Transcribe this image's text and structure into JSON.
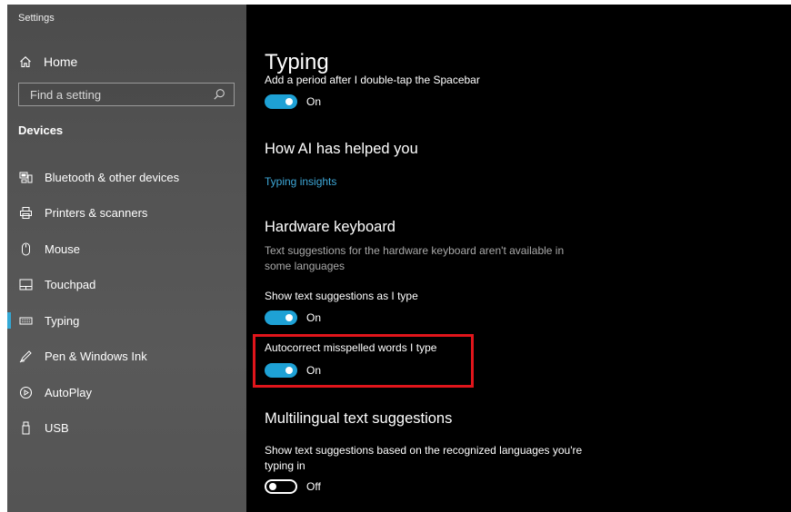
{
  "app": {
    "title": "Settings"
  },
  "sidebar": {
    "home_label": "Home",
    "search_placeholder": "Find a setting",
    "section_label": "Devices",
    "items": [
      {
        "label": "Bluetooth & other devices",
        "icon": "bluetooth-devices-icon"
      },
      {
        "label": "Printers & scanners",
        "icon": "printer-icon"
      },
      {
        "label": "Mouse",
        "icon": "mouse-icon"
      },
      {
        "label": "Touchpad",
        "icon": "touchpad-icon"
      },
      {
        "label": "Typing",
        "icon": "keyboard-icon",
        "selected": true
      },
      {
        "label": "Pen & Windows Ink",
        "icon": "pen-icon"
      },
      {
        "label": "AutoPlay",
        "icon": "autoplay-icon"
      },
      {
        "label": "USB",
        "icon": "usb-icon"
      }
    ],
    "accent_color": "#33a9d6"
  },
  "content": {
    "page_title": "Typing",
    "period_setting": {
      "label": "Add a period after I double-tap the Spacebar",
      "state": "On"
    },
    "ai_section": {
      "heading": "How AI has helped you",
      "link": "Typing insights"
    },
    "hardware_section": {
      "heading": "Hardware keyboard",
      "description": "Text suggestions for the hardware keyboard aren't available in some languages",
      "text_suggestions": {
        "label": "Show text suggestions as I type",
        "state": "On"
      },
      "autocorrect": {
        "label": "Autocorrect misspelled words I type",
        "state": "On"
      }
    },
    "multilingual_section": {
      "heading": "Multilingual text suggestions",
      "description": "Show text suggestions based on the recognized languages you're typing in",
      "toggle": {
        "state": "Off"
      }
    },
    "toggle_on_color": "#1ea1d5",
    "highlight_color": "#e0151b"
  }
}
